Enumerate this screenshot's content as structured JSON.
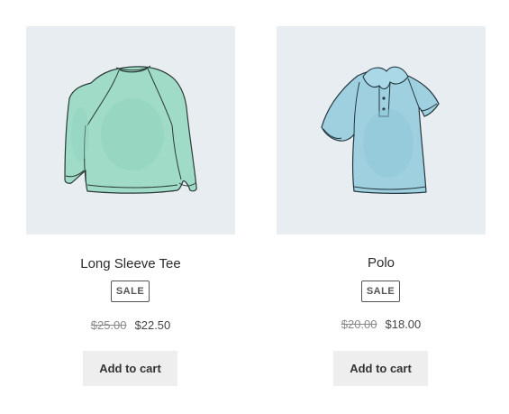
{
  "products": [
    {
      "title": "Long Sleeve Tee",
      "badge": "SALE",
      "old_price": "$25.00",
      "new_price": "$22.50",
      "button_label": "Add to cart",
      "image_icon": "long-sleeve-tee-icon",
      "shirt_color": "#9fdbc7"
    },
    {
      "title": "Polo",
      "badge": "SALE",
      "old_price": "$20.00",
      "new_price": "$18.00",
      "button_label": "Add to cart",
      "image_icon": "polo-shirt-icon",
      "shirt_color": "#9fd0df"
    }
  ],
  "colors": {
    "thumb_background": "#e8edf1",
    "button_background": "#eeeeee",
    "text": "#333333"
  }
}
